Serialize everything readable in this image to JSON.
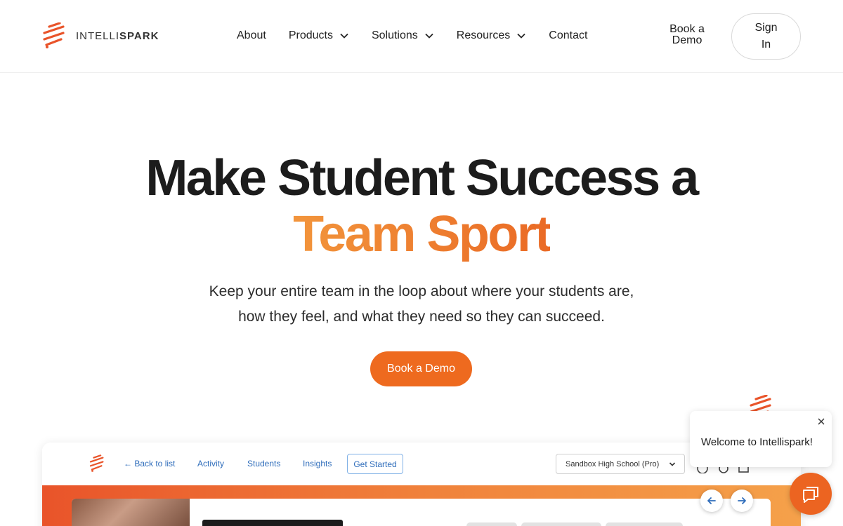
{
  "brand": {
    "name_light": "INTELLI",
    "name_bold": "SPARK",
    "accent_color": "#ee6a1f",
    "logo_icon": "intellispark-spark-icon"
  },
  "nav": {
    "items": [
      {
        "label": "About",
        "has_dropdown": false
      },
      {
        "label": "Products",
        "has_dropdown": true
      },
      {
        "label": "Solutions",
        "has_dropdown": true
      },
      {
        "label": "Resources",
        "has_dropdown": true
      },
      {
        "label": "Contact",
        "has_dropdown": false
      }
    ],
    "book_demo": "Book a Demo",
    "sign_in": "Sign In"
  },
  "hero": {
    "title_line1": "Make Student Success a",
    "title_line2": "Team Sport",
    "subtitle_line1": "Keep your entire team in the loop about where your students are,",
    "subtitle_line2": "how they feel, and what they need so they can succeed.",
    "cta": "Book a Demo"
  },
  "preview": {
    "back_link": "← Back to list",
    "tabs": [
      "Activity",
      "Students",
      "Insights"
    ],
    "get_started": "Get Started",
    "school_select": "Sandbox High School (Pro)"
  },
  "chat": {
    "message": "Welcome to Intellispark!"
  }
}
